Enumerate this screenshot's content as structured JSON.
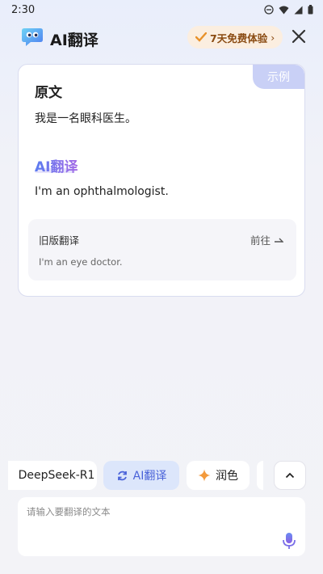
{
  "status_bar": {
    "time": "2:30"
  },
  "header": {
    "title": "AI翻译",
    "trial_badge": "7天免费体验",
    "trial_chevron": "›"
  },
  "card": {
    "example_tag": "示例",
    "original_title": "原文",
    "original_text": "我是一名眼科医生。",
    "ai_title": "AI翻译",
    "ai_text": "I'm an ophthalmologist.",
    "old_version": {
      "label": "旧版翻译",
      "goto": "前往",
      "text": "I'm an eye doctor."
    }
  },
  "toolbar": {
    "model": "DeepSeek-R1",
    "ai_translate": "AI翻译",
    "polish": "润色"
  },
  "input": {
    "placeholder": "请输入要翻译的文本"
  },
  "colors": {
    "accent": "#4a63d9",
    "badge_bg": "#fbeee0",
    "badge_text": "#8a4b12",
    "example_tag_bg": "#c9d0f6"
  },
  "icons": [
    "minus-circle-icon",
    "wifi-icon",
    "signal-icon",
    "battery-icon",
    "logo-icon",
    "close-icon",
    "swap-icon",
    "sparkle-icon",
    "chevron-up-icon",
    "mic-icon",
    "arrow-icon"
  ]
}
